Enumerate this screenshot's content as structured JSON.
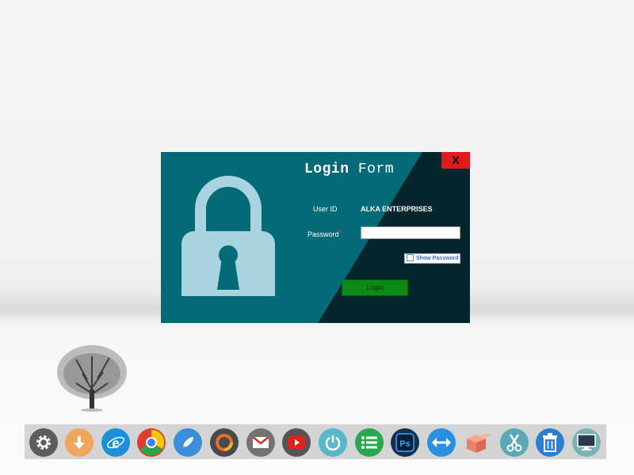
{
  "window": {
    "title_word1": "Login",
    "title_word2": "Form",
    "close_label": "X"
  },
  "form": {
    "user_id_label": "User ID",
    "user_id_value": "ALKA ENTERPRISES",
    "password_label": "Password",
    "required_mark": "*",
    "password_value": "",
    "show_password_label": "Show Password",
    "login_label": "Login"
  },
  "colors": {
    "window_bg": "#036b78",
    "window_dark": "#05262c",
    "close_bg": "#e01b1b",
    "login_btn": "#0b8a15"
  },
  "dock": {
    "items": [
      {
        "name": "system-settings",
        "icon": "gear-icon"
      },
      {
        "name": "downloads",
        "icon": "download-arrow-icon"
      },
      {
        "name": "internet-explorer",
        "icon": "ie-icon"
      },
      {
        "name": "chrome",
        "icon": "chrome-icon"
      },
      {
        "name": "launcher",
        "icon": "rocket-icon"
      },
      {
        "name": "chromium-app",
        "icon": "c-ring-icon"
      },
      {
        "name": "gmail",
        "icon": "mail-icon"
      },
      {
        "name": "youtube",
        "icon": "play-icon"
      },
      {
        "name": "power",
        "icon": "power-icon"
      },
      {
        "name": "tasks",
        "icon": "list-icon"
      },
      {
        "name": "photoshop",
        "icon": "photoshop-icon"
      },
      {
        "name": "resize",
        "icon": "arrows-horizontal-icon"
      },
      {
        "name": "packages",
        "icon": "boxes-icon"
      },
      {
        "name": "snipping",
        "icon": "scissors-icon"
      },
      {
        "name": "recycle-bin",
        "icon": "trash-icon"
      },
      {
        "name": "this-pc",
        "icon": "monitor-icon"
      }
    ]
  }
}
